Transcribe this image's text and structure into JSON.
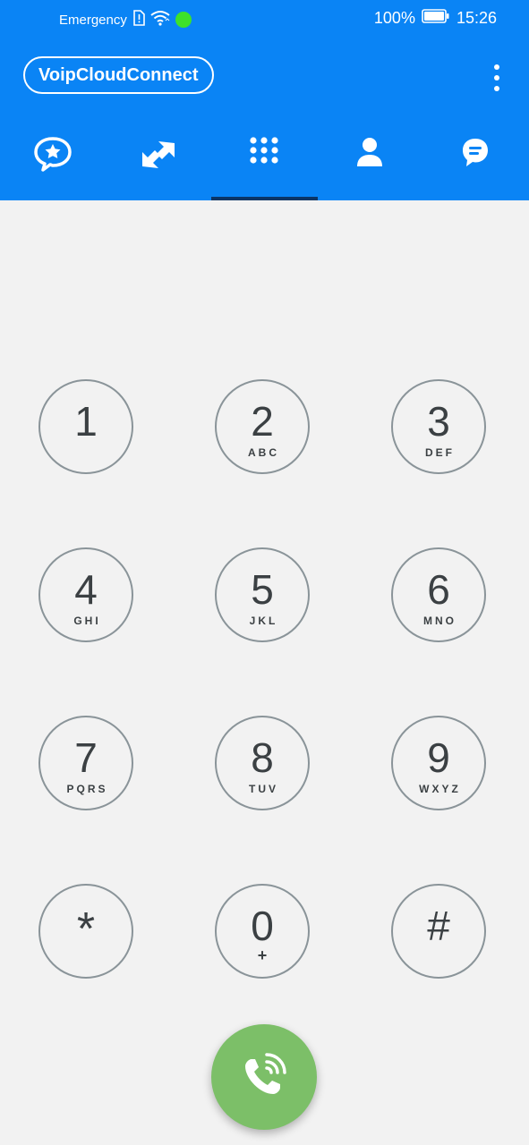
{
  "status_bar": {
    "carrier": "Emergency",
    "battery": "100%",
    "time": "15:26",
    "icons": [
      "sim-alert-icon",
      "wifi-icon",
      "green-dot-indicator",
      "battery-icon"
    ]
  },
  "app": {
    "title": "VoipCloudConnect",
    "accent_color": "#0a84f5",
    "call_color": "#7cbf68",
    "menu_icon": "more-vert-icon"
  },
  "tabs": [
    {
      "name": "favorites",
      "icon": "star-chat-icon",
      "selected": false
    },
    {
      "name": "recents",
      "icon": "call-arrows-icon",
      "selected": false
    },
    {
      "name": "dialpad",
      "icon": "dialpad-icon",
      "selected": true
    },
    {
      "name": "contacts",
      "icon": "person-icon",
      "selected": false
    },
    {
      "name": "messages",
      "icon": "chat-bubble-icon",
      "selected": false
    }
  ],
  "keypad": [
    {
      "digit": "1",
      "letters": ""
    },
    {
      "digit": "2",
      "letters": "ABC"
    },
    {
      "digit": "3",
      "letters": "DEF"
    },
    {
      "digit": "4",
      "letters": "GHI"
    },
    {
      "digit": "5",
      "letters": "JKL"
    },
    {
      "digit": "6",
      "letters": "MNO"
    },
    {
      "digit": "7",
      "letters": "PQRS"
    },
    {
      "digit": "8",
      "letters": "TUV"
    },
    {
      "digit": "9",
      "letters": "WXYZ"
    },
    {
      "digit": "*",
      "letters": ""
    },
    {
      "digit": "0",
      "letters": "+"
    },
    {
      "digit": "#",
      "letters": ""
    }
  ],
  "call_button_icon": "phone-ringing-icon"
}
